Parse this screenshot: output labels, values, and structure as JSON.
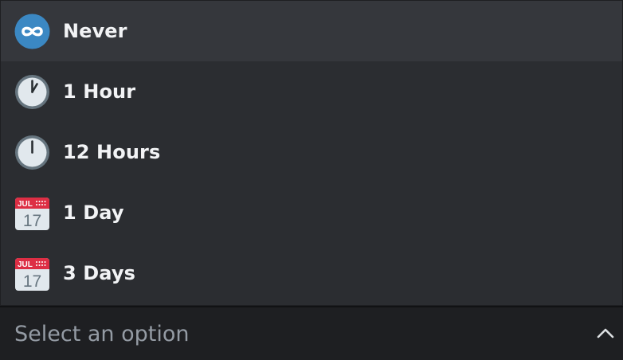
{
  "menu": {
    "options": [
      {
        "label": "Never",
        "icon": "infinity-icon",
        "selected": true
      },
      {
        "label": "1 Hour",
        "icon": "clock-one-icon",
        "selected": false
      },
      {
        "label": "12 Hours",
        "icon": "clock-twelve-icon",
        "selected": false
      },
      {
        "label": "1 Day",
        "icon": "calendar-icon",
        "selected": false,
        "calendar_month": "JUL",
        "calendar_day": "17"
      },
      {
        "label": "3 Days",
        "icon": "calendar-icon",
        "selected": false,
        "calendar_month": "JUL",
        "calendar_day": "17"
      }
    ]
  },
  "select": {
    "placeholder": "Select an option",
    "chevron_icon": "chevron-up-icon"
  },
  "colors": {
    "background": "#2b2d31",
    "selected_row": "#35373c",
    "select_bar": "#1e1f22",
    "text": "#f2f3f5",
    "placeholder": "#949ba4",
    "infinity_badge": "#3b88c3",
    "calendar_red": "#dd2e44"
  }
}
